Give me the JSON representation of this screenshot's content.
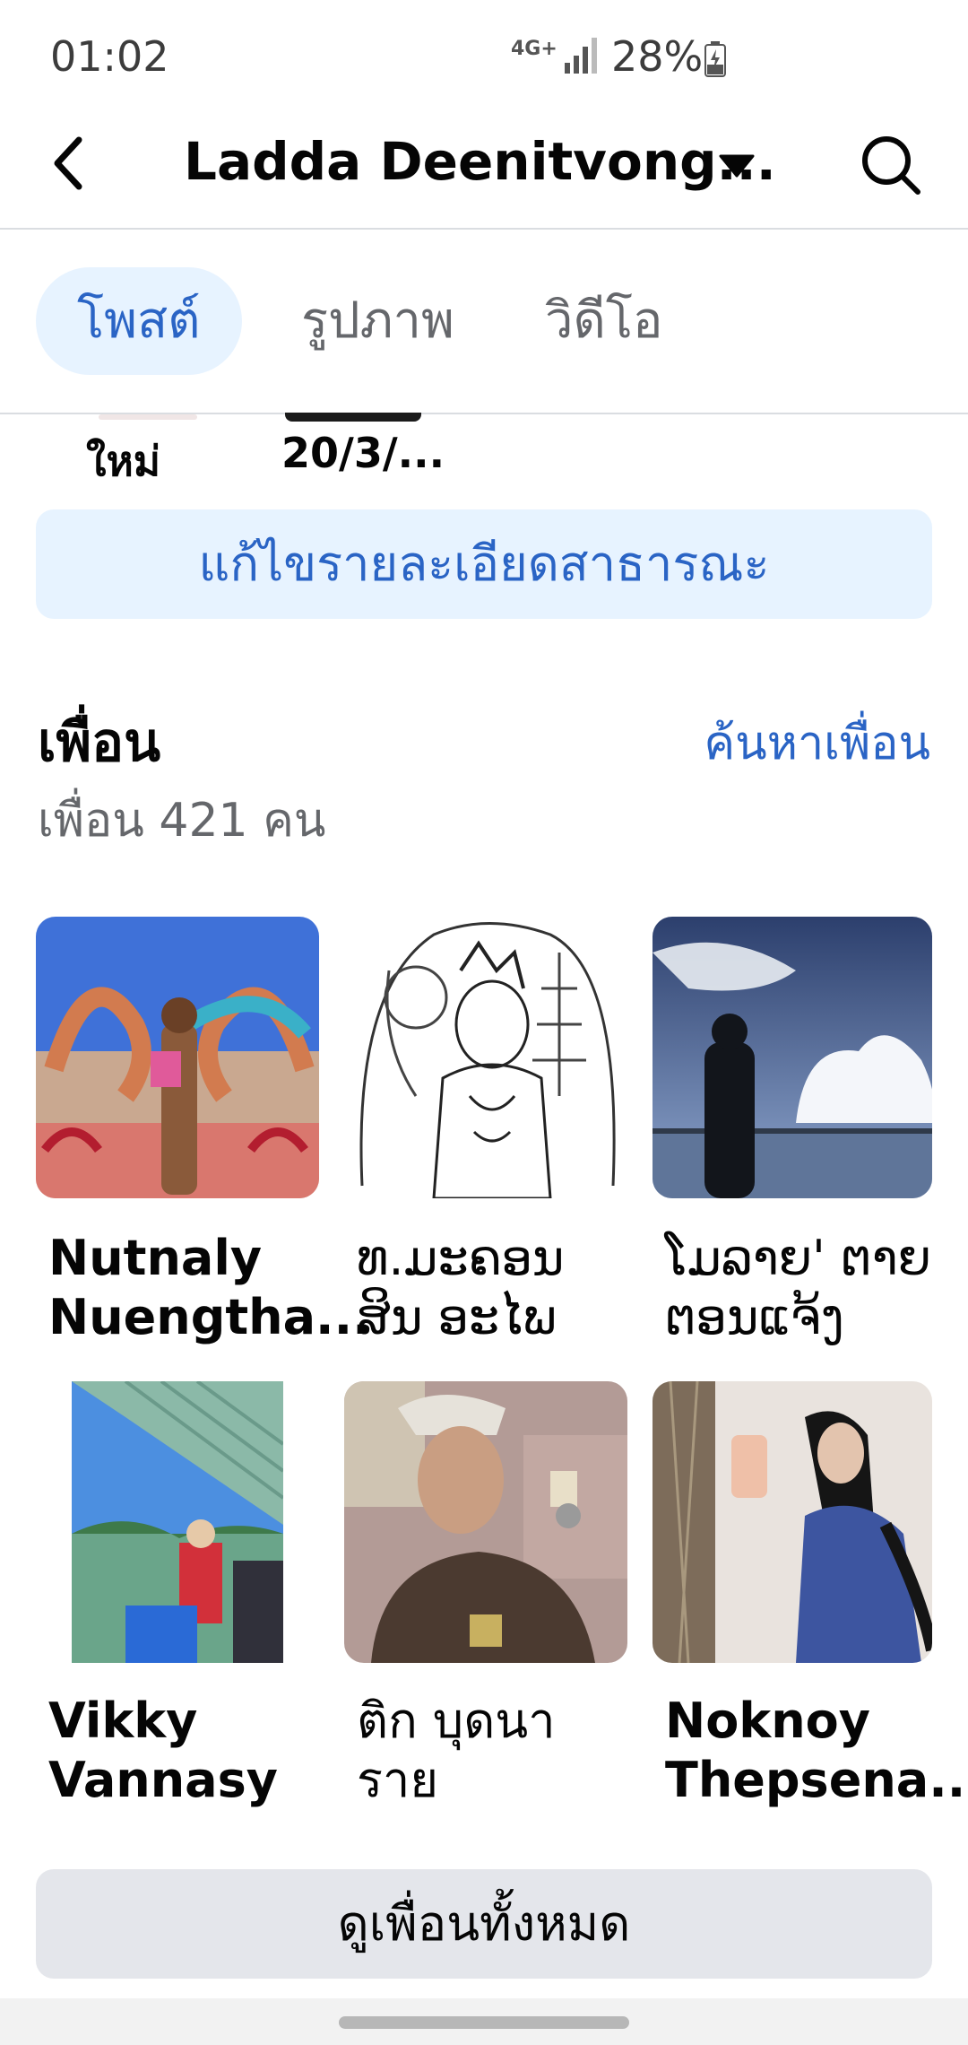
{
  "status_bar": {
    "time": "01:02",
    "network": "4G+",
    "battery": "28%"
  },
  "header": {
    "title": "Ladda Deenitvong..."
  },
  "tabs": [
    {
      "label": "โพสต์",
      "active": true
    },
    {
      "label": "รูปภาพ",
      "active": false
    },
    {
      "label": "วิดีโอ",
      "active": false
    }
  ],
  "partial_row": {
    "label_1": "ใหม่",
    "label_2": "20/3/..."
  },
  "edit_button": {
    "label": "แก้ไขรายละเอียดสาธารณะ"
  },
  "friends": {
    "title": "เพื่อน",
    "find_link": "ค้นหาเพื่อน",
    "count": "เพื่อน 421 คน",
    "list": [
      {
        "line1": "Nutnaly",
        "line2": "Nuengtha..."
      },
      {
        "line1": "ທ.ມະຄອນ",
        "line2": "ສິນ ອະໄພ"
      },
      {
        "line1": "ໂມລາຍ' ຕາຍ",
        "line2": "ຕອນແຈ້ງ"
      },
      {
        "line1": "Vikky",
        "line2": "Vannasy"
      },
      {
        "line1": "ติก บุดนา",
        "line2": "ราย"
      },
      {
        "line1": "Noknoy",
        "line2": "Thepsena..."
      }
    ],
    "see_all": "ดูเพื่อนทั้งหมด"
  },
  "colors": {
    "accent": "#2a64c5",
    "accent_bg": "#e7f3ff",
    "divider": "#dadde1",
    "secondary_text": "#65676b"
  }
}
